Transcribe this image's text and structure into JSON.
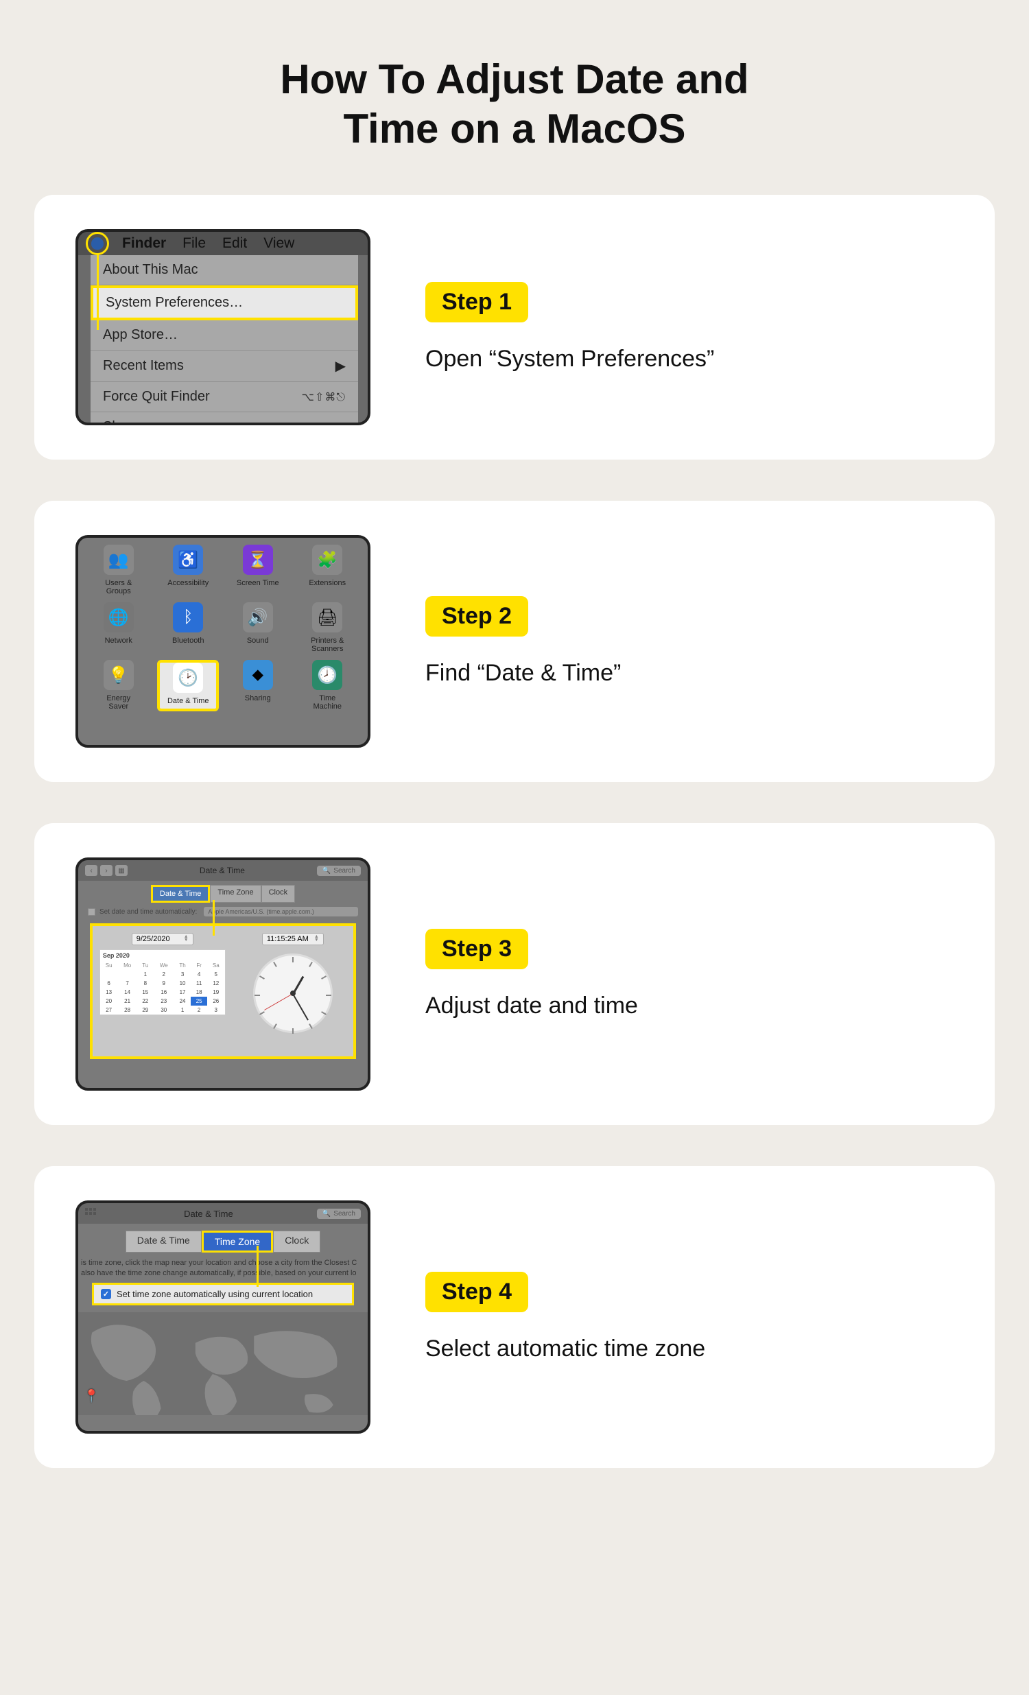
{
  "title_line1": "How To Adjust Date and",
  "title_line2": "Time on a MacOS",
  "steps": [
    {
      "badge": "Step 1",
      "text": "Open “System Preferences”"
    },
    {
      "badge": "Step 2",
      "text": "Find “Date & Time”"
    },
    {
      "badge": "Step 3",
      "text": "Adjust date and time"
    },
    {
      "badge": "Step 4",
      "text": "Select automatic time zone"
    }
  ],
  "step1": {
    "menubar": {
      "finder": "Finder",
      "file": "File",
      "edit": "Edit",
      "view": "View"
    },
    "menu": {
      "about": "About This Mac",
      "sysprefs": "System Preferences…",
      "appstore": "App Store…",
      "recent": "Recent Items",
      "forcequit": "Force Quit Finder",
      "forcequit_shortcut": "⌥⇧⌘⎋",
      "sleep": "Sleep"
    }
  },
  "step2": {
    "row1": [
      "Users &\nGroups",
      "Accessibility",
      "Screen Time",
      "Extensions"
    ],
    "row2": [
      "Network",
      "Bluetooth",
      "Sound",
      "Printers &\nScanners"
    ],
    "row3": [
      "Energy\nSaver",
      "Date & Time",
      "Sharing",
      "Time\nMachine"
    ]
  },
  "step3": {
    "window_title": "Date & Time",
    "search": "Search",
    "tabs": [
      "Date & Time",
      "Time Zone",
      "Clock"
    ],
    "autocheck": "Set date and time automatically:",
    "server": "Apple Americas/U.S. (time.apple.com.)",
    "date_field": "9/25/2020",
    "time_field": "11:15:25 AM",
    "month": "Sep 2020",
    "days": [
      "Su",
      "Mo",
      "Tu",
      "We",
      "Th",
      "Fr",
      "Sa"
    ],
    "weeks": [
      [
        "",
        "",
        "1",
        "2",
        "3",
        "4",
        "5"
      ],
      [
        "6",
        "7",
        "8",
        "9",
        "10",
        "11",
        "12"
      ],
      [
        "13",
        "14",
        "15",
        "16",
        "17",
        "18",
        "19"
      ],
      [
        "20",
        "21",
        "22",
        "23",
        "24",
        "25",
        "26"
      ],
      [
        "27",
        "28",
        "29",
        "30",
        "1",
        "2",
        "3"
      ]
    ],
    "today": "25"
  },
  "step4": {
    "window_title": "Date & Time",
    "search": "Search",
    "tabs": [
      "Date & Time",
      "Time Zone",
      "Clock"
    ],
    "help": "is time zone, click the map near your location and choose a city from the Closest C\nalso have the time zone change automatically, if possible, based on your current lo",
    "autobox": "Set time zone automatically using current location"
  }
}
